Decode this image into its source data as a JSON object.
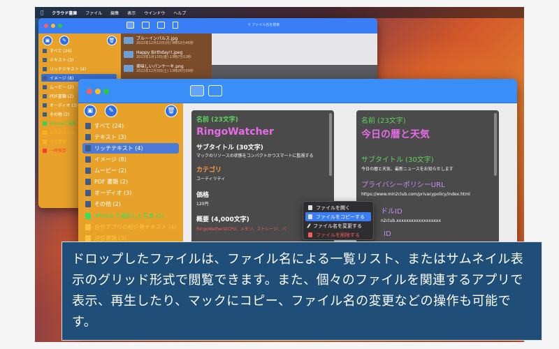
{
  "menubar": {
    "app_name": "クラウド書庫",
    "items": [
      "ファイル",
      "編集",
      "表示",
      "ウインドウ",
      "ヘルプ"
    ]
  },
  "back_window": {
    "search_placeholder": "ファイル名を検索",
    "sidebar": [
      {
        "label": "すべて (24)"
      },
      {
        "label": "テキスト (3)"
      },
      {
        "label": "リッチテキスト (4)"
      },
      {
        "label": "イメージ (8)"
      },
      {
        "label": "ムービー (2)"
      },
      {
        "label": "PDF書類 (2)"
      },
      {
        "label": "オーディオ (3)"
      },
      {
        "label": "その他 (2)"
      },
      {
        "label": "iPhoneで撮影"
      },
      {
        "label": "自作アプリの"
      },
      {
        "label": "送信書類"
      },
      {
        "label": "一時保存"
      }
    ],
    "files": [
      {
        "name": "ブルーインパルス.jpg",
        "date": "2022年12月12日(月) 9時53分46秒"
      },
      {
        "name": "Happy Birthday!!.jpeg",
        "date": "2023年1月13日(金) 13時7分13秒"
      },
      {
        "name": "美味しいパンケーキ.png",
        "date": "2022年12月3日(土) 13時26分59秒"
      }
    ]
  },
  "front_window": {
    "sidebar": [
      {
        "label": "すべて (24)"
      },
      {
        "label": "テキスト (3)"
      },
      {
        "label": "リッチテキスト (4)"
      },
      {
        "label": "イメージ (8)"
      },
      {
        "label": "ムービー (2)"
      },
      {
        "label": "PDF 書類 (2)"
      },
      {
        "label": "オーディオ (3)"
      },
      {
        "label": "その他 (2)"
      },
      {
        "label": "iPhone で撮影した写真 (5)"
      },
      {
        "label": "自作アプリの紹介用テキスト (4)"
      },
      {
        "label": "送信書類 (3)"
      }
    ],
    "card1": {
      "name_label": "名前 (23文字)",
      "name_value": "RingoWatcher",
      "subtitle_label": "サブタイトル (30文字)",
      "subtitle_value": "マックのリソースの状態をコンパクトかつスマートに監視する",
      "category_label": "カテゴリ",
      "category_value": "ユーティリティ",
      "price_label": "価格",
      "price_value": "120円",
      "overview_label": "概要 (4,000文字)",
      "overview_value": "RingoWatherはCPU、メモリ、ストレージ、バ"
    },
    "card2": {
      "name_label": "名前 (23文字)",
      "name_value": "今日の暦と天気",
      "subtitle_label": "サブタイトル (30文字)",
      "subtitle_value": "今日の暦と天気、最新ニュースをお知らせします",
      "privacy_label": "プライバシーポリシーURL",
      "privacy_value": "https://www.min2club.com/privacypolicy/index.html",
      "bundle_label": "ドルID",
      "bundle_value": "n2club.xxxxxxxxxxxxxxxxxx",
      "sku_label": "ID"
    },
    "context_menu": [
      {
        "label": "ファイルを開く"
      },
      {
        "label": "ファイルをコピーする"
      },
      {
        "label": "ファイル名を変更する"
      },
      {
        "label": "ファイルを削除する"
      }
    ]
  },
  "caption": {
    "text": "ドロップしたファイルは、ファイル名による一覧リスト、またはサムネイル表示のグリッド形式で閲覧できます。また、個々のファイルを関連するアプリで表示、再生したり、マックにコピー、ファイル名の変更などの操作も可能です。"
  },
  "colors": {
    "toolbar_blue": "#3a8ef8",
    "sidebar_orange": "#e8a22a",
    "caption_bg": "#1f4f78"
  }
}
